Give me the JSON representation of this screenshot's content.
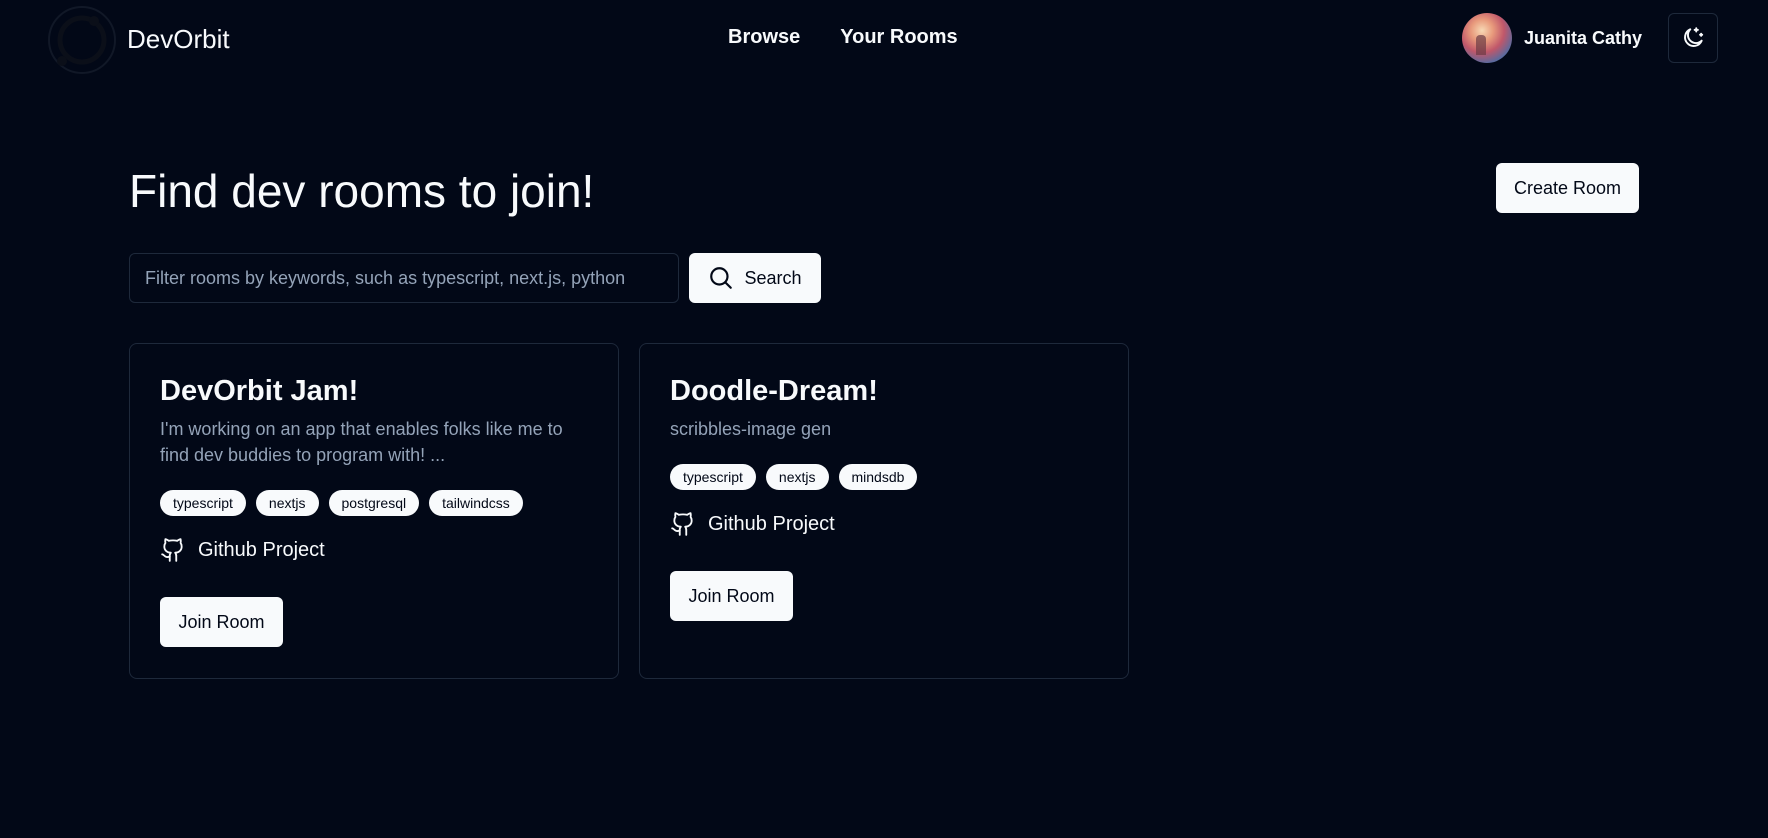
{
  "header": {
    "brand": "DevOrbit",
    "nav": [
      {
        "label": "Browse"
      },
      {
        "label": "Your Rooms"
      }
    ],
    "user_name": "Juanita Cathy",
    "theme_icon": "moon-stars-icon"
  },
  "main": {
    "title": "Find dev rooms to join!",
    "create_label": "Create Room",
    "search": {
      "placeholder": "Filter rooms by keywords, such as typescript, next.js, python",
      "value": "",
      "button_label": "Search"
    },
    "rooms": [
      {
        "name": "DevOrbit Jam!",
        "description": "I'm working on an app that enables folks like me to find dev buddies to program with! ...",
        "tags": [
          "typescript",
          "nextjs",
          "postgresql",
          "tailwindcss"
        ],
        "github_label": "Github Project",
        "join_label": "Join Room"
      },
      {
        "name": "Doodle-Dream!",
        "description": "scribbles-image gen",
        "tags": [
          "typescript",
          "nextjs",
          "mindsdb"
        ],
        "github_label": "Github Project",
        "join_label": "Join Room"
      }
    ]
  },
  "colors": {
    "background": "#020817",
    "foreground": "#f8fafc",
    "muted": "#94a3b8",
    "border": "#1e293b"
  }
}
